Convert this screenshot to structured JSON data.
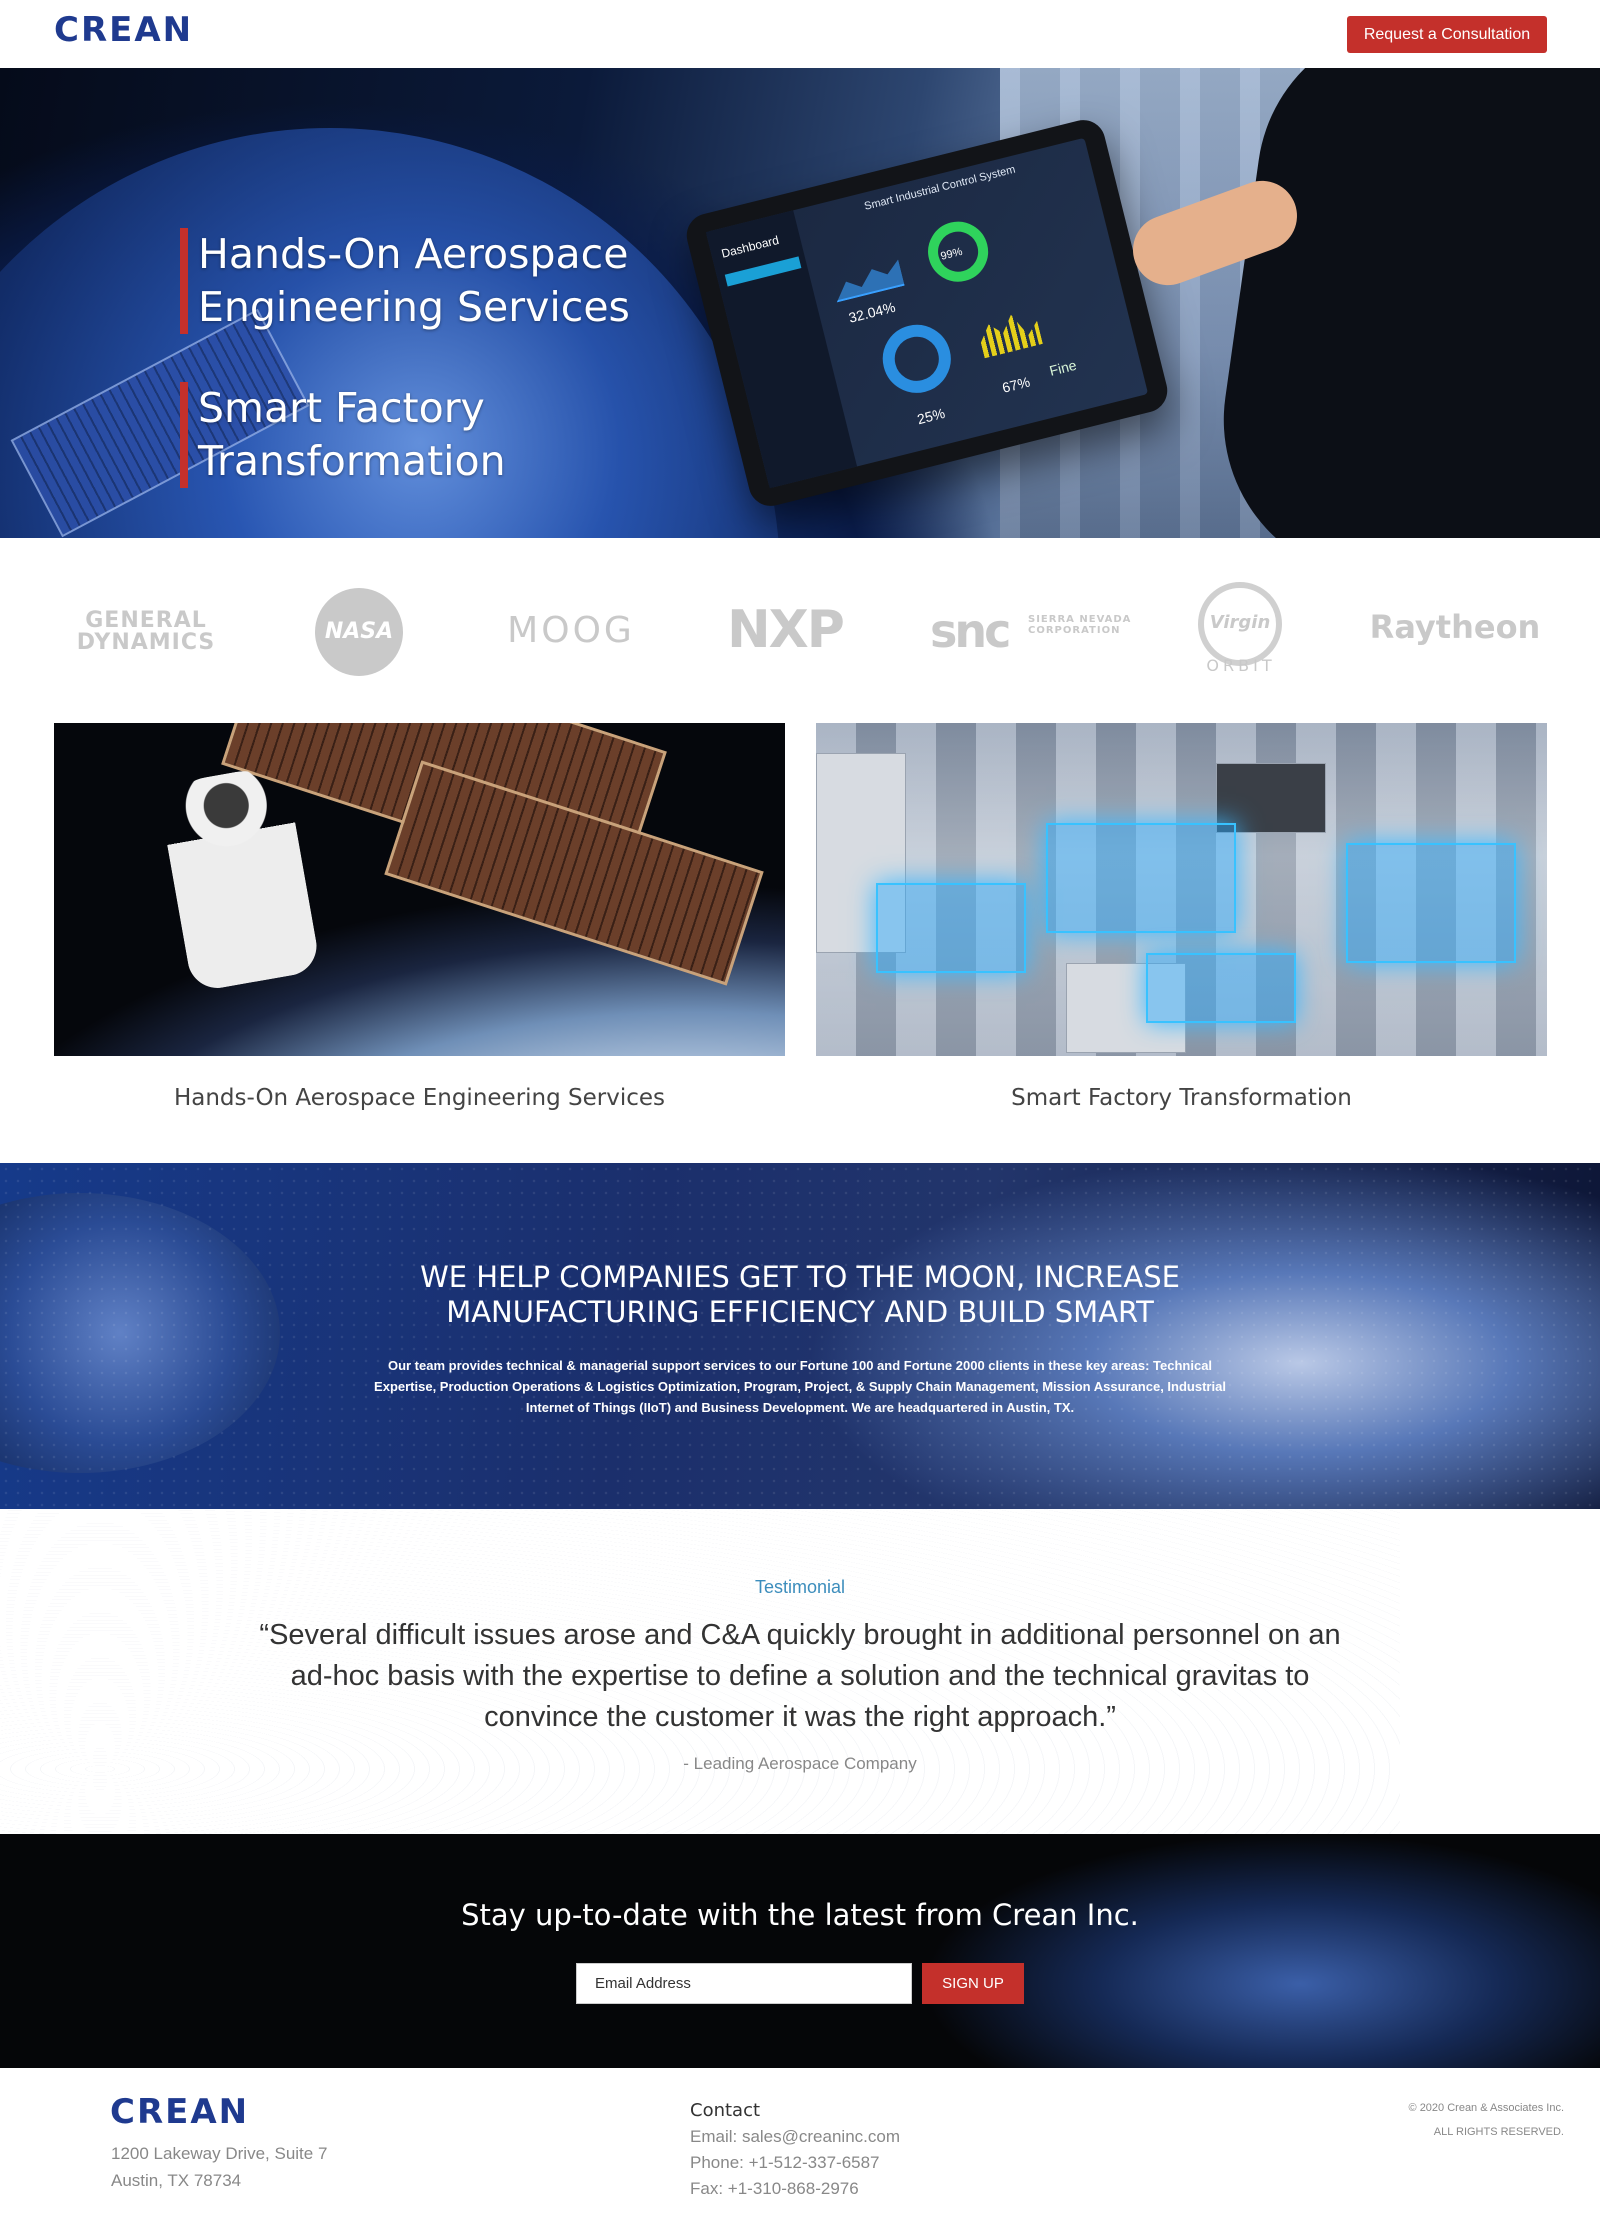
{
  "header": {
    "logo": "CREAN",
    "cta_label": "Request a Consultation"
  },
  "hero": {
    "headings": [
      "Hands-On Aerospace Engineering Services",
      "Smart Factory Transformation"
    ],
    "tablet": {
      "title": "Smart Industrial Control System",
      "sidebar_title": "Dashboard",
      "stats": [
        "32.04%",
        "99%",
        "25%",
        "67%",
        "Fine"
      ]
    }
  },
  "clients": {
    "general_dynamics": "GENERAL DYNAMICS",
    "nasa": "NASA",
    "moog": "MOOG",
    "nxp": "NXP",
    "snc": "snc",
    "snc_sub": "SIERRA NEVADA CORPORATION",
    "virgin": "Virgin",
    "orbit": "ORBIT",
    "raytheon": "Raytheon"
  },
  "services": [
    {
      "caption": "Hands-On Aerospace Engineering Services"
    },
    {
      "caption": "Smart Factory Transformation"
    }
  ],
  "mission": {
    "heading": "WE HELP COMPANIES GET TO THE MOON, INCREASE MANUFACTURING EFFICIENCY AND BUILD SMART",
    "body": "Our team provides technical & managerial support services to our Fortune 100 and Fortune 2000 clients in these key areas: Technical Expertise, Production Operations & Logistics Optimization, Program, Project, & Supply Chain Management, Mission Assurance, Industrial Internet of Things (IIoT) and Business Development.  We are headquartered in Austin, TX."
  },
  "testimonial": {
    "label": "Testimonial",
    "quote": "“Several difficult issues arose and C&A quickly brought in additional personnel on an ad-hoc basis with the expertise to define a solution and the technical gravitas to convince the customer it was the right approach.”",
    "source": "- Leading Aerospace Company"
  },
  "newsletter": {
    "heading": "Stay up-to-date with the latest from Crean Inc.",
    "email_placeholder": "Email Address",
    "signup_label": "SIGN UP"
  },
  "footer": {
    "logo": "CREAN",
    "address_line1": "1200 Lakeway Drive, Suite 7",
    "address_line2": "Austin, TX 78734",
    "contact_title": "Contact",
    "email": "Email: sales@creaninc.com",
    "phone": "Phone: +1-512-337-6587",
    "fax": "Fax: +1-310-868-2976",
    "copyright": "© 2020 Crean & Associates Inc.",
    "rights": "ALL RIGHTS RESERVED."
  },
  "colors": {
    "brand_blue": "#1f3a8f",
    "accent_red": "#c4302b",
    "testimonial_label": "#3c8dbc"
  }
}
